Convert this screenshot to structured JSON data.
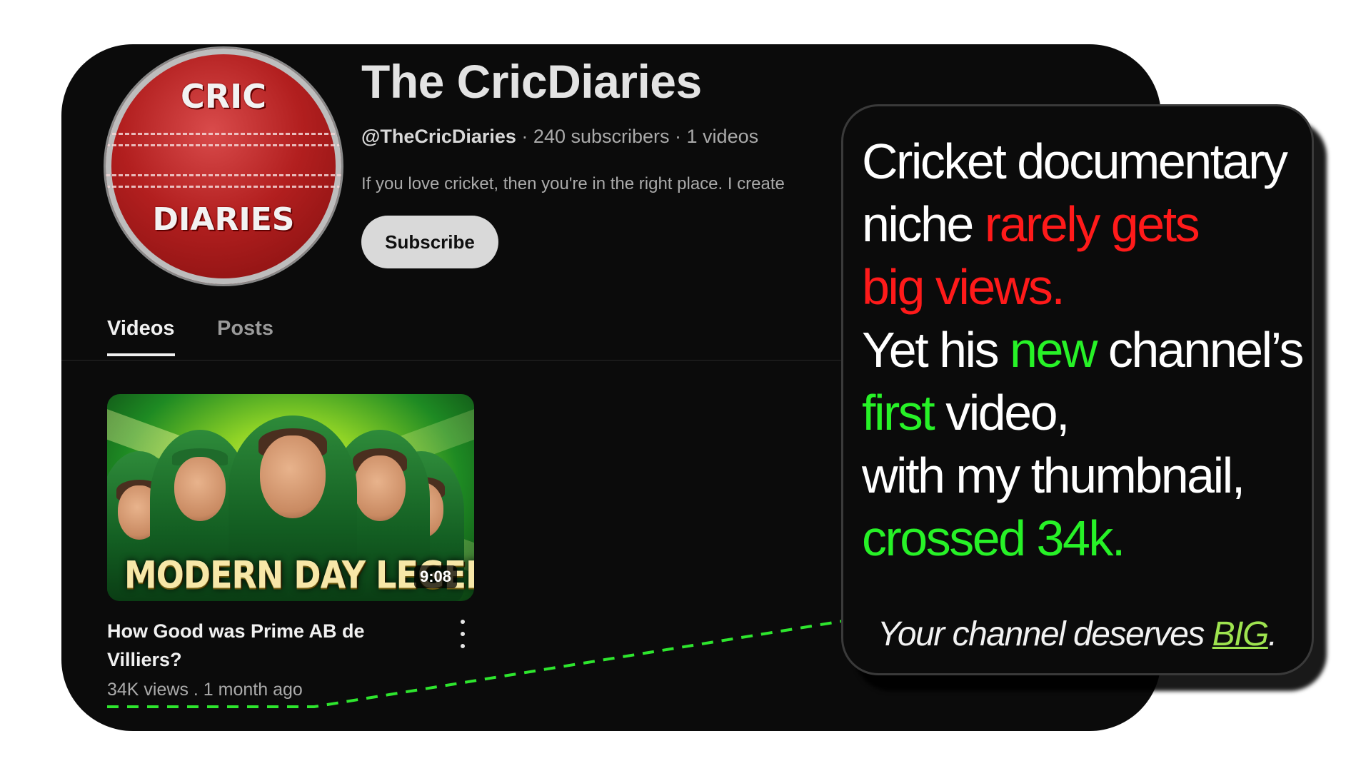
{
  "channel": {
    "avatar_text_top": "CRIC",
    "avatar_text_bottom": "DIARIES",
    "name": "The CricDiaries",
    "handle": "@TheCricDiaries",
    "subscribers": "240 subscribers",
    "videos": "1 videos",
    "meta_separator": " · ",
    "description": "If you love cricket, then you're in the right place. I create",
    "subscribe_label": "Subscribe"
  },
  "tabs": [
    {
      "label": "Videos",
      "active": true
    },
    {
      "label": "Posts",
      "active": false
    }
  ],
  "video": {
    "thumbnail_headline": "MODERN DAY LEGEND",
    "duration": "9:08",
    "title": "How Good was Prime AB de Villiers?",
    "views": "34K views",
    "age": "1 month ago",
    "meta_separator": " . "
  },
  "callout": {
    "lines": [
      [
        {
          "t": "Cricket documentary",
          "c": "white"
        }
      ],
      [
        {
          "t": "niche ",
          "c": "white"
        },
        {
          "t": "rarely gets",
          "c": "red"
        }
      ],
      [
        {
          "t": "big views.",
          "c": "red"
        }
      ],
      [
        {
          "t": "Yet his ",
          "c": "white"
        },
        {
          "t": "new",
          "c": "green"
        },
        {
          "t": " channel’s",
          "c": "white"
        }
      ],
      [
        {
          "t": "first",
          "c": "green"
        },
        {
          "t": " video,",
          "c": "white"
        }
      ],
      [
        {
          "t": "with my thumbnail,",
          "c": "white"
        }
      ],
      [
        {
          "t": "crossed 34k.",
          "c": "green"
        }
      ]
    ],
    "tagline_prefix": "Your channel deserves ",
    "tagline_highlight": "BIG",
    "tagline_suffix": "."
  },
  "colors": {
    "background": "#ffffff",
    "card": "#0b0b0b",
    "red": "#ff1a1a",
    "green": "#27f227",
    "connector": "#2ee62e"
  }
}
